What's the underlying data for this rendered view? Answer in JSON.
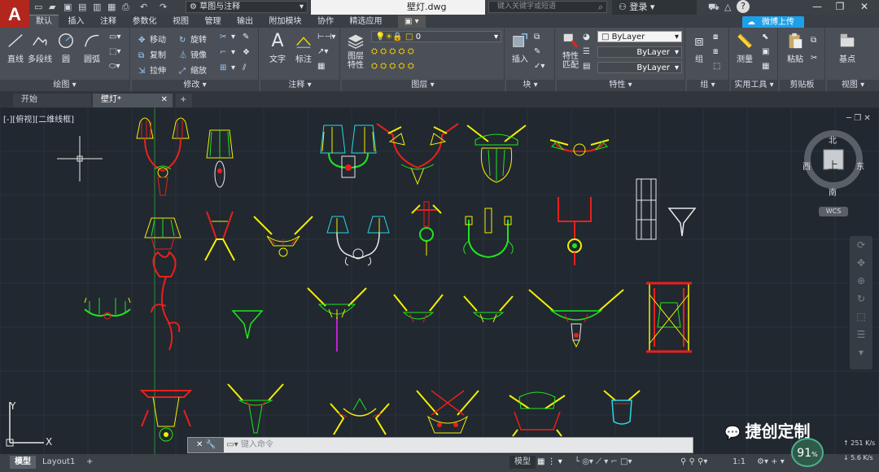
{
  "titlebar": {
    "app_letter": "A",
    "workspace": "草图与注释",
    "document_title": "壁灯.dwg",
    "search_placeholder": "键入关键字或短语",
    "signin": "登录",
    "help": "?"
  },
  "ribbon_tabs": [
    "默认",
    "插入",
    "注释",
    "参数化",
    "视图",
    "管理",
    "输出",
    "附加模块",
    "协作",
    "精选应用"
  ],
  "upload_button": "微博上传",
  "panels": {
    "draw": {
      "title": "绘图 ▾",
      "line": "直线",
      "polyline": "多段线",
      "circle": "圆",
      "arc": "圆弧"
    },
    "modify": {
      "title": "修改 ▾",
      "move": "移动",
      "rotate": "旋转",
      "copy": "复制",
      "mirror": "镜像",
      "stretch": "拉伸",
      "scale": "缩放"
    },
    "annotation": {
      "title": "注释 ▾",
      "text": "文字",
      "dimension": "标注"
    },
    "layers": {
      "title": "图层 ▾",
      "layer_properties": "图层\n特性",
      "current_layer": "0"
    },
    "block": {
      "title": "块 ▾",
      "insert": "插入"
    },
    "properties": {
      "title": "特性 ▾",
      "match": "特性\n匹配",
      "color": "ByLayer",
      "linetype": "ByLayer",
      "lineweight": "ByLayer"
    },
    "groups": {
      "title": "组 ▾",
      "group": "组"
    },
    "utilities": {
      "title": "实用工具 ▾",
      "measure": "测量"
    },
    "clipboard": {
      "title": "剪贴板",
      "paste": "粘贴"
    },
    "view": {
      "title": "视图 ▾",
      "base": "基点"
    }
  },
  "file_tabs": [
    "开始",
    "壁灯*",
    "+"
  ],
  "viewport_label": "[-][俯视][二维线框]",
  "viewcube": {
    "north": "北",
    "south": "南",
    "east": "东",
    "west": "西",
    "top": "上",
    "wcs": "WCS"
  },
  "ucs": {
    "x": "X",
    "y": "Y"
  },
  "command_placeholder": "键入命令",
  "layout_tabs": [
    "模型",
    "Layout1",
    "+"
  ],
  "status": {
    "model": "模型",
    "scale": "1:1",
    "speed_percent": "91",
    "speed_unit": "%",
    "upload_rate": "251",
    "download_rate": "5.6",
    "rate_unit": "K/s"
  },
  "watermark": "捷创定制",
  "colors": {
    "yellow": "#f4f000",
    "red": "#e8201c",
    "green": "#1ee61e",
    "cyan": "#2ad8e6",
    "white": "#e8e8e8",
    "magenta": "#c020d0",
    "grid": "#2a323b",
    "background": "#212830"
  }
}
